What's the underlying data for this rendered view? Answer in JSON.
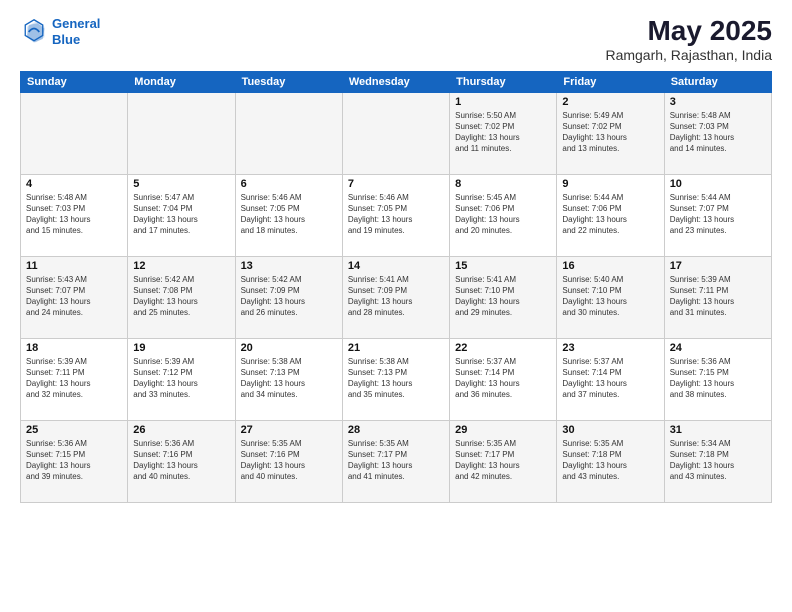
{
  "logo": {
    "line1": "General",
    "line2": "Blue"
  },
  "title": "May 2025",
  "subtitle": "Ramgarh, Rajasthan, India",
  "days_of_week": [
    "Sunday",
    "Monday",
    "Tuesday",
    "Wednesday",
    "Thursday",
    "Friday",
    "Saturday"
  ],
  "weeks": [
    [
      {
        "num": "",
        "detail": ""
      },
      {
        "num": "",
        "detail": ""
      },
      {
        "num": "",
        "detail": ""
      },
      {
        "num": "",
        "detail": ""
      },
      {
        "num": "1",
        "detail": "Sunrise: 5:50 AM\nSunset: 7:02 PM\nDaylight: 13 hours\nand 11 minutes."
      },
      {
        "num": "2",
        "detail": "Sunrise: 5:49 AM\nSunset: 7:02 PM\nDaylight: 13 hours\nand 13 minutes."
      },
      {
        "num": "3",
        "detail": "Sunrise: 5:48 AM\nSunset: 7:03 PM\nDaylight: 13 hours\nand 14 minutes."
      }
    ],
    [
      {
        "num": "4",
        "detail": "Sunrise: 5:48 AM\nSunset: 7:03 PM\nDaylight: 13 hours\nand 15 minutes."
      },
      {
        "num": "5",
        "detail": "Sunrise: 5:47 AM\nSunset: 7:04 PM\nDaylight: 13 hours\nand 17 minutes."
      },
      {
        "num": "6",
        "detail": "Sunrise: 5:46 AM\nSunset: 7:05 PM\nDaylight: 13 hours\nand 18 minutes."
      },
      {
        "num": "7",
        "detail": "Sunrise: 5:46 AM\nSunset: 7:05 PM\nDaylight: 13 hours\nand 19 minutes."
      },
      {
        "num": "8",
        "detail": "Sunrise: 5:45 AM\nSunset: 7:06 PM\nDaylight: 13 hours\nand 20 minutes."
      },
      {
        "num": "9",
        "detail": "Sunrise: 5:44 AM\nSunset: 7:06 PM\nDaylight: 13 hours\nand 22 minutes."
      },
      {
        "num": "10",
        "detail": "Sunrise: 5:44 AM\nSunset: 7:07 PM\nDaylight: 13 hours\nand 23 minutes."
      }
    ],
    [
      {
        "num": "11",
        "detail": "Sunrise: 5:43 AM\nSunset: 7:07 PM\nDaylight: 13 hours\nand 24 minutes."
      },
      {
        "num": "12",
        "detail": "Sunrise: 5:42 AM\nSunset: 7:08 PM\nDaylight: 13 hours\nand 25 minutes."
      },
      {
        "num": "13",
        "detail": "Sunrise: 5:42 AM\nSunset: 7:09 PM\nDaylight: 13 hours\nand 26 minutes."
      },
      {
        "num": "14",
        "detail": "Sunrise: 5:41 AM\nSunset: 7:09 PM\nDaylight: 13 hours\nand 28 minutes."
      },
      {
        "num": "15",
        "detail": "Sunrise: 5:41 AM\nSunset: 7:10 PM\nDaylight: 13 hours\nand 29 minutes."
      },
      {
        "num": "16",
        "detail": "Sunrise: 5:40 AM\nSunset: 7:10 PM\nDaylight: 13 hours\nand 30 minutes."
      },
      {
        "num": "17",
        "detail": "Sunrise: 5:39 AM\nSunset: 7:11 PM\nDaylight: 13 hours\nand 31 minutes."
      }
    ],
    [
      {
        "num": "18",
        "detail": "Sunrise: 5:39 AM\nSunset: 7:11 PM\nDaylight: 13 hours\nand 32 minutes."
      },
      {
        "num": "19",
        "detail": "Sunrise: 5:39 AM\nSunset: 7:12 PM\nDaylight: 13 hours\nand 33 minutes."
      },
      {
        "num": "20",
        "detail": "Sunrise: 5:38 AM\nSunset: 7:13 PM\nDaylight: 13 hours\nand 34 minutes."
      },
      {
        "num": "21",
        "detail": "Sunrise: 5:38 AM\nSunset: 7:13 PM\nDaylight: 13 hours\nand 35 minutes."
      },
      {
        "num": "22",
        "detail": "Sunrise: 5:37 AM\nSunset: 7:14 PM\nDaylight: 13 hours\nand 36 minutes."
      },
      {
        "num": "23",
        "detail": "Sunrise: 5:37 AM\nSunset: 7:14 PM\nDaylight: 13 hours\nand 37 minutes."
      },
      {
        "num": "24",
        "detail": "Sunrise: 5:36 AM\nSunset: 7:15 PM\nDaylight: 13 hours\nand 38 minutes."
      }
    ],
    [
      {
        "num": "25",
        "detail": "Sunrise: 5:36 AM\nSunset: 7:15 PM\nDaylight: 13 hours\nand 39 minutes."
      },
      {
        "num": "26",
        "detail": "Sunrise: 5:36 AM\nSunset: 7:16 PM\nDaylight: 13 hours\nand 40 minutes."
      },
      {
        "num": "27",
        "detail": "Sunrise: 5:35 AM\nSunset: 7:16 PM\nDaylight: 13 hours\nand 40 minutes."
      },
      {
        "num": "28",
        "detail": "Sunrise: 5:35 AM\nSunset: 7:17 PM\nDaylight: 13 hours\nand 41 minutes."
      },
      {
        "num": "29",
        "detail": "Sunrise: 5:35 AM\nSunset: 7:17 PM\nDaylight: 13 hours\nand 42 minutes."
      },
      {
        "num": "30",
        "detail": "Sunrise: 5:35 AM\nSunset: 7:18 PM\nDaylight: 13 hours\nand 43 minutes."
      },
      {
        "num": "31",
        "detail": "Sunrise: 5:34 AM\nSunset: 7:18 PM\nDaylight: 13 hours\nand 43 minutes."
      }
    ]
  ]
}
